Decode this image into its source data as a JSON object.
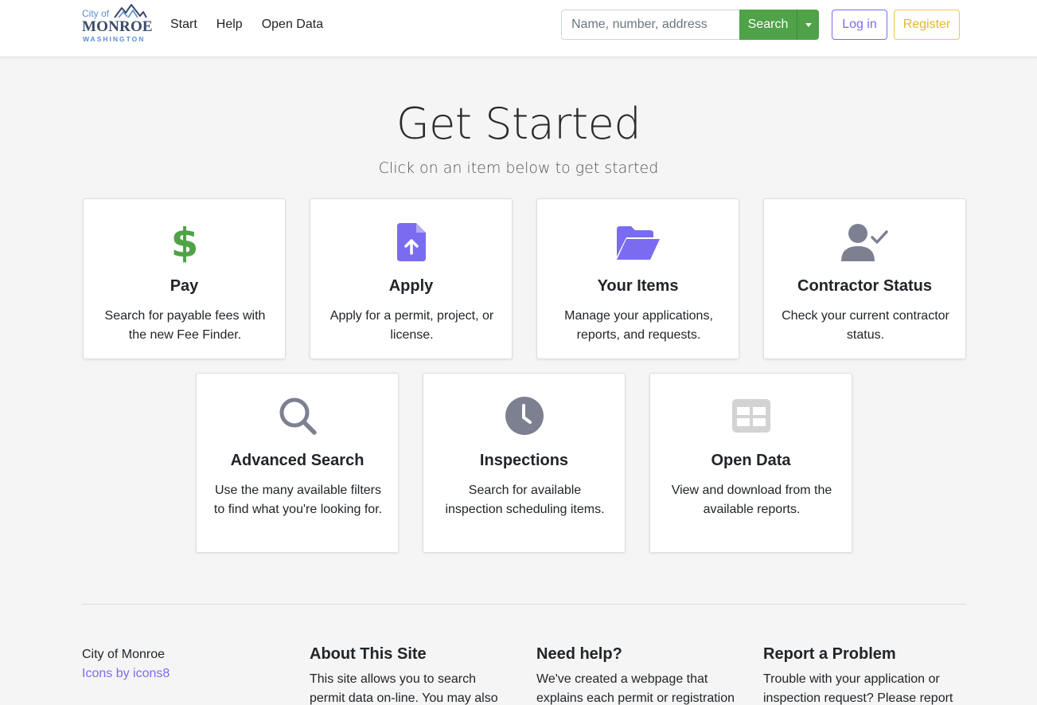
{
  "header": {
    "logo": {
      "city": "City of",
      "name": "MONROE",
      "state": "WASHINGTON"
    },
    "nav": [
      {
        "label": "Start"
      },
      {
        "label": "Help"
      },
      {
        "label": "Open Data"
      }
    ],
    "search": {
      "placeholder": "Name, number, address",
      "value": "",
      "button_label": "Search"
    },
    "login_label": "Log in",
    "register_label": "Register"
  },
  "hero": {
    "title": "Get Started",
    "subtitle": "Click on an item below to get started"
  },
  "cards": [
    {
      "title": "Pay",
      "text": "Search for payable fees with the new Fee Finder.",
      "icon": "dollar-icon"
    },
    {
      "title": "Apply",
      "text": "Apply for a permit, project, or license.",
      "icon": "file-upload-icon"
    },
    {
      "title": "Your Items",
      "text": "Manage your applications, reports, and requests.",
      "icon": "folder-open-icon"
    },
    {
      "title": "Contractor Status",
      "text": "Check your current contractor status.",
      "icon": "user-check-icon"
    },
    {
      "title": "Advanced Search",
      "text": "Use the many available filters to find what you're looking for.",
      "icon": "search-icon"
    },
    {
      "title": "Inspections",
      "text": "Search for available inspection scheduling items.",
      "icon": "clock-icon"
    },
    {
      "title": "Open Data",
      "text": "View and download from the available reports.",
      "icon": "table-icon"
    }
  ],
  "footer": {
    "org": "City of Monroe",
    "credit_link": "Icons by icons8",
    "about": {
      "heading": "About This Site",
      "text": "This site allows you to search permit data on-line. You may also"
    },
    "help": {
      "heading": "Need help?",
      "text": "We've created a webpage that explains each permit or registration"
    },
    "report": {
      "heading": "Report a Problem",
      "text": "Trouble with your application or inspection request? Please report"
    }
  },
  "colors": {
    "primary": "#7a6cf0",
    "success": "#4fa247",
    "warning": "#f2c94c",
    "icon_gray": "#7d8091",
    "icon_light": "#d3d3d3"
  }
}
